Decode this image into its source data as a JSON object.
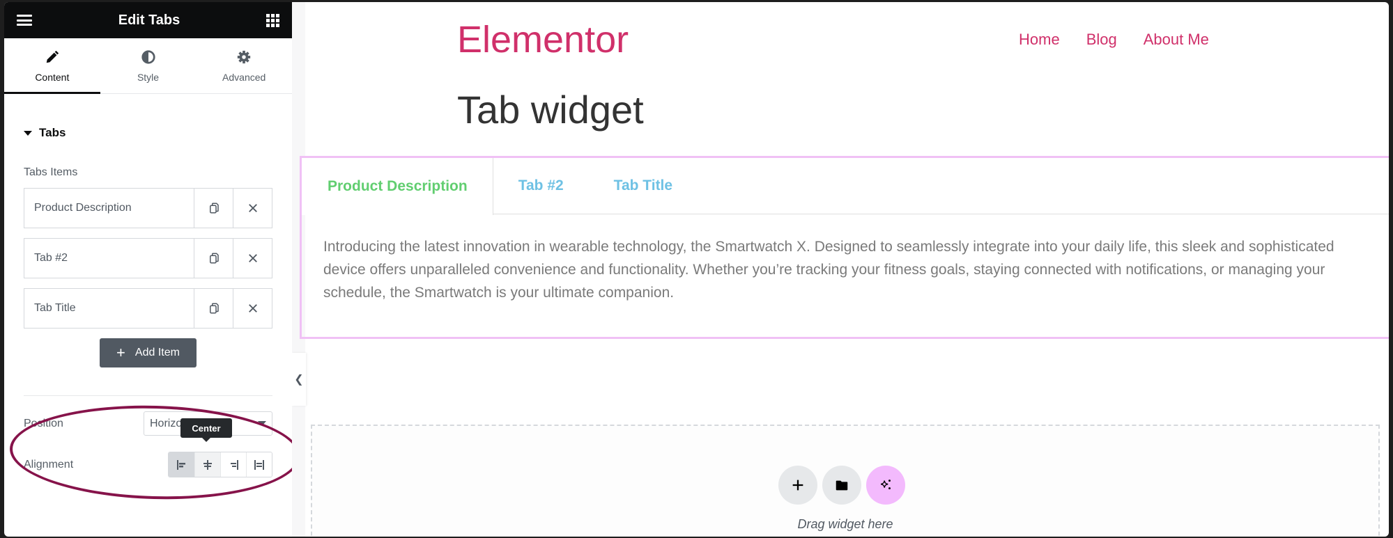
{
  "panel": {
    "title": "Edit Tabs",
    "icons": {
      "menu": "hamburger-icon",
      "widgets": "grid-icon"
    },
    "tabs": [
      {
        "label": "Content",
        "icon": "pencil-icon",
        "active": true
      },
      {
        "label": "Style",
        "icon": "half-circle-icon",
        "active": false
      },
      {
        "label": "Advanced",
        "icon": "gear-icon",
        "active": false
      }
    ],
    "section_title": "Tabs",
    "items_label": "Tabs Items",
    "items": [
      {
        "title": "Product Description"
      },
      {
        "title": "Tab #2"
      },
      {
        "title": "Tab Title"
      }
    ],
    "add_item_label": "Add Item",
    "position": {
      "label": "Position",
      "value": "Horizontal"
    },
    "alignment": {
      "label": "Alignment",
      "options": [
        "Start",
        "Center",
        "End",
        "Justified"
      ],
      "selected": "Start",
      "tooltip": "Center"
    },
    "annotation_color": "#86134a"
  },
  "preview": {
    "site_logo": "Elementor",
    "nav": [
      "Home",
      "Blog",
      "About Me"
    ],
    "page_title": "Tab widget",
    "tabs": [
      {
        "label": "Product Description",
        "active": true
      },
      {
        "label": "Tab #2",
        "active": false
      },
      {
        "label": "Tab Title",
        "active": false
      }
    ],
    "tab_content": "Introducing the latest innovation in wearable technology, the Smartwatch X. Designed to seamlessly integrate into your daily life, this sleek and sophisticated device offers unparalleled convenience and functionality. Whether you’re tracking your fitness goals, staying connected with notifications, or managing your schedule, the Smartwatch is your ultimate companion.",
    "drop_zone_text": "Drag widget here",
    "colors": {
      "brand": "#d0306a",
      "active_tab": "#61ce70",
      "inactive_tab": "#6ec1e4",
      "widget_outline": "#f0c1f5"
    }
  }
}
